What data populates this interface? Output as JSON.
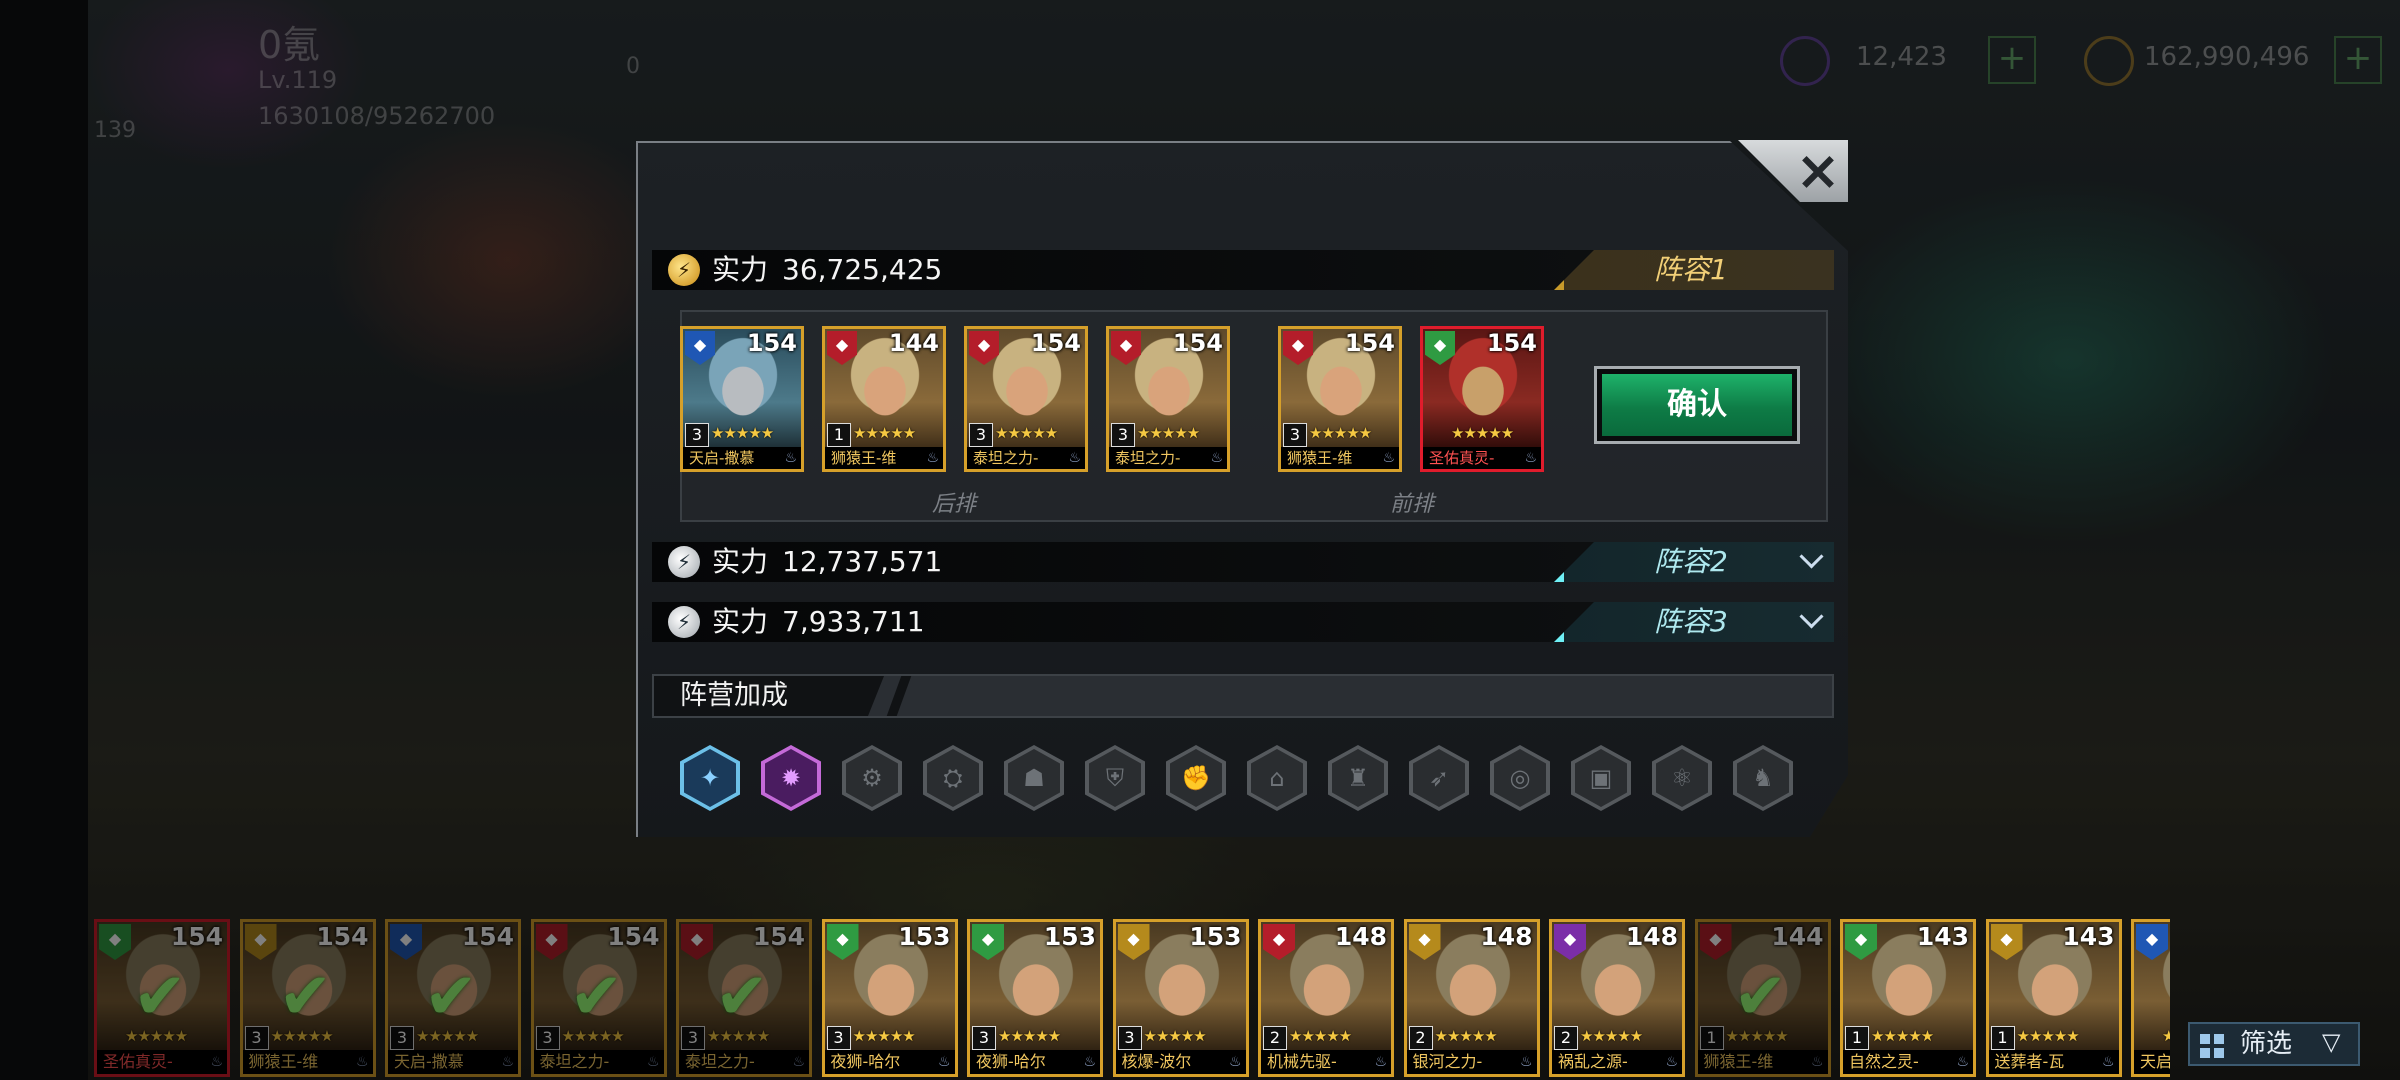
{
  "top": {
    "profile_name": "0氪",
    "level": "Lv.119",
    "exp": "1630108/95262700",
    "badge_value": "0",
    "side_value": "139",
    "resource1": "12,423",
    "resource2": "162,990,496"
  },
  "dialog": {
    "close_icon": "×",
    "lineups": [
      {
        "label": "实力",
        "power": "36,725,425",
        "team": "阵容1",
        "expanded": true
      },
      {
        "label": "实力",
        "power": "12,737,571",
        "team": "阵容2",
        "expanded": false
      },
      {
        "label": "实力",
        "power": "7,933,711",
        "team": "阵容3",
        "expanded": false
      }
    ],
    "back_row_label": "后排",
    "front_row_label": "前排",
    "slots": [
      {
        "name": "天启-撒慕",
        "level": "154",
        "tier": "3",
        "faction": "blue",
        "frame": "gold"
      },
      {
        "name": "狮猿王-维",
        "level": "144",
        "tier": "1",
        "faction": "red",
        "frame": "gold"
      },
      {
        "name": "泰坦之力-",
        "level": "154",
        "tier": "3",
        "faction": "red",
        "frame": "gold"
      },
      {
        "name": "泰坦之力-",
        "level": "154",
        "tier": "3",
        "faction": "red",
        "frame": "gold"
      },
      {
        "name": "狮猿王-维",
        "level": "154",
        "tier": "3",
        "faction": "red",
        "frame": "gold"
      },
      {
        "name": "圣佑真灵-",
        "level": "154",
        "tier": "",
        "faction": "green",
        "frame": "red"
      }
    ],
    "confirm_label": "确认",
    "camp_bonus_label": "阵营加成",
    "camp_icons": [
      "blue-beast",
      "purple-flame",
      "gear",
      "mech",
      "mask",
      "shield",
      "fist",
      "ruins",
      "robot",
      "wing",
      "spiral",
      "crate",
      "skull-gear",
      "wolf"
    ]
  },
  "roster": [
    {
      "name": "圣佑真灵-",
      "level": "154",
      "tier": "",
      "faction": "green",
      "frame": "red",
      "used": true
    },
    {
      "name": "狮猿王-维",
      "level": "154",
      "tier": "3",
      "faction": "gold",
      "frame": "gold",
      "used": true
    },
    {
      "name": "天启-撒慕",
      "level": "154",
      "tier": "3",
      "faction": "blue",
      "frame": "gold",
      "used": true
    },
    {
      "name": "泰坦之力-",
      "level": "154",
      "tier": "3",
      "faction": "red",
      "frame": "gold",
      "used": true
    },
    {
      "name": "泰坦之力-",
      "level": "154",
      "tier": "3",
      "faction": "red",
      "frame": "gold",
      "used": true
    },
    {
      "name": "夜狮-哈尔",
      "level": "153",
      "tier": "3",
      "faction": "green",
      "frame": "gold",
      "used": false
    },
    {
      "name": "夜狮-哈尔",
      "level": "153",
      "tier": "3",
      "faction": "green",
      "frame": "gold",
      "used": false
    },
    {
      "name": "核爆-波尔",
      "level": "153",
      "tier": "3",
      "faction": "gold",
      "frame": "gold",
      "used": false
    },
    {
      "name": "机械先驱-",
      "level": "148",
      "tier": "2",
      "faction": "red",
      "frame": "gold",
      "used": false
    },
    {
      "name": "银河之力-",
      "level": "148",
      "tier": "2",
      "faction": "gold",
      "frame": "gold",
      "used": false
    },
    {
      "name": "祸乱之源-",
      "level": "148",
      "tier": "2",
      "faction": "purple",
      "frame": "gold",
      "used": false
    },
    {
      "name": "狮猿王-维",
      "level": "144",
      "tier": "1",
      "faction": "red",
      "frame": "gold",
      "used": true
    },
    {
      "name": "自然之灵-",
      "level": "143",
      "tier": "1",
      "faction": "green",
      "frame": "gold",
      "used": false
    },
    {
      "name": "送葬者-瓦",
      "level": "143",
      "tier": "1",
      "faction": "gold",
      "frame": "gold",
      "used": false
    },
    {
      "name": "天启",
      "level": "",
      "tier": "",
      "faction": "blue",
      "frame": "gold",
      "used": false
    }
  ],
  "filter": {
    "label": "筛选",
    "icon": "▽"
  },
  "stars": "★★★★★",
  "checkmark": "✔"
}
